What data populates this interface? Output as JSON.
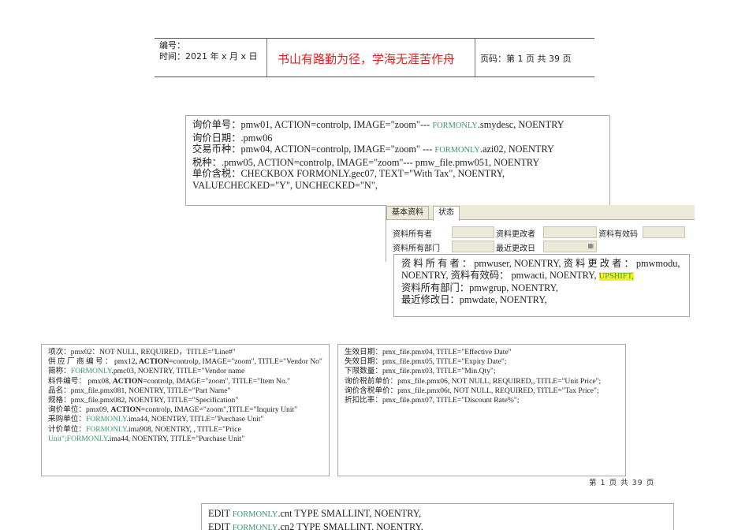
{
  "header": {
    "number_label": "编号：",
    "time_label": "时间：2021 年 x 月 x 日",
    "motto": "书山有路勤为径，学海无涯苦作舟",
    "page_info": "页码：第 1 页  共 39 页"
  },
  "box1": [
    [
      {
        "t": "询价单号：pmw01, ACTION=controlp, IMAGE=\"zoom\"--- "
      },
      {
        "t": "FORMONLY",
        "s": "gs"
      },
      {
        "t": ".smydesc, NOENTRY"
      }
    ],
    [
      {
        "t": "询价日期：.pmw06"
      }
    ],
    [
      {
        "t": "交易币种：pmw04, ACTION=controlp, IMAGE=\"zoom\" --- "
      },
      {
        "t": "FORMONLY",
        "s": "gs"
      },
      {
        "t": ".azi02, NOENTRY"
      }
    ],
    [
      {
        "t": "税种：.pmw05, ACTION=controlp, IMAGE=\"zoom\"--- pmw_file.pmw051, NOENTRY"
      }
    ],
    [
      {
        "t": "单价含税：CHECKBOX  FORMONLY.gec07, TEXT=\"With Tax\", NOENTRY, VALUECHECKED=\"Y\", UNCHECKED=\"N\","
      }
    ]
  ],
  "form": {
    "tabs": [
      "基本资料",
      "状态"
    ],
    "labels": [
      "资料所有者",
      "资料更改者",
      "资料有效码",
      "资料所有部门",
      "最近更改日"
    ]
  },
  "box2": [
    [
      {
        "t": "资 料 所 有 者 ： pmwuser,  NOENTRY,  资 料 更 改 者 ： pmwmodu, NOENTRY, 资料有效码：  pmwacti, NOENTRY, "
      },
      {
        "t": "UPSHIFT,",
        "s": "hl"
      }
    ],
    [
      {
        "t": "资料所有部门：pmwgrup, NOENTRY,"
      }
    ],
    [
      {
        "t": "最近修改日：pmwdate, NOENTRY,"
      }
    ]
  ],
  "box3": [
    [
      {
        "t": "项次：pmx02：NOT NULL, REQUIRED，TITLE=\"Line#\""
      }
    ],
    [
      {
        "t": "供 应 厂 商 编 号 ： pmx12"
      },
      {
        "t": ", ACTION=",
        "s": "b"
      },
      {
        "t": "controlp, IMAGE=\"zoom\", TITLE=\"Vendor No\""
      }
    ],
    [
      {
        "t": "简称："
      },
      {
        "t": "FORMONLY",
        "s": "g"
      },
      {
        "t": ".pmc03, NOENTRY, TITLE=\"Vendor name"
      }
    ],
    [
      {
        "t": "料件编号：  pmx08, "
      },
      {
        "t": "ACTION=",
        "s": "b"
      },
      {
        "t": "controlp, IMAGE=\"zoom\", TITLE=\"Item No.\""
      }
    ],
    [
      {
        "t": "品名：pmx_file.pmx081, NOENTRY, TITLE=\"Part Name\""
      }
    ],
    [
      {
        "t": "规格：pmx_file.pmx082, NOENTRY, TITLE=\"Specification\""
      }
    ],
    [
      {
        "t": "询价单位：pmx09, "
      },
      {
        "t": "ACTION=",
        "s": "b"
      },
      {
        "t": "controlp, IMAGE=\"zoom\",TITLE=\"Inquiry Unit\""
      }
    ],
    [
      {
        "t": "采购单位："
      },
      {
        "t": "FORMONLY",
        "s": "g"
      },
      {
        "t": ".ima44, NOENTRY, TITLE=\"Purchase Unit\""
      }
    ],
    [
      {
        "t": "计价单位："
      },
      {
        "t": "FORMONLY",
        "s": "g"
      },
      {
        "t": ".ima908, NOENTRY, , TITLE=\"Price "
      },
      {
        "t": "Unit\";FORMONLY",
        "s": "g"
      },
      {
        "t": ".ima44, NOENTRY, TITLE=\"Purchase Unit\""
      }
    ]
  ],
  "box4": [
    [
      {
        "t": "生效日期：pmx_file.pmx04, TITLE=\"Effective Date\""
      }
    ],
    [
      {
        "t": "失效日期：pmx_file.pmx05,  TITLE=\"Expiry Date\";"
      }
    ],
    [
      {
        "t": "下限数量：pmx_file.pmx03, TITLE=\"Min.Qty\";"
      }
    ],
    [
      {
        "t": "询价税前单价：pmx_file.pmx06, NOT NULL, REQUIRED,, TITLE=\"Unit Price\";"
      }
    ],
    [
      {
        "t": "询价含税单价：pmx_file.pmx06t, NOT NULL, REQUIRED, TITLE=\"Tax Price\";"
      }
    ],
    [
      {
        "t": "折扣比率：pmx_file.pmx07, TITLE=\"Discount Rate%\";"
      }
    ]
  ],
  "footer": "第 1 页 共 39 页",
  "box5": [
    [
      {
        "t": "EDIT  "
      },
      {
        "t": "FORMONLY",
        "s": "gs"
      },
      {
        "t": ".cnt TYPE SMALLINT, NOENTRY,"
      }
    ],
    [
      {
        "t": "EDIT  "
      },
      {
        "t": "FORMONLY",
        "s": "gs"
      },
      {
        "t": ".cn2 TYPE SMALLINT, NOENTRY,"
      }
    ]
  ]
}
